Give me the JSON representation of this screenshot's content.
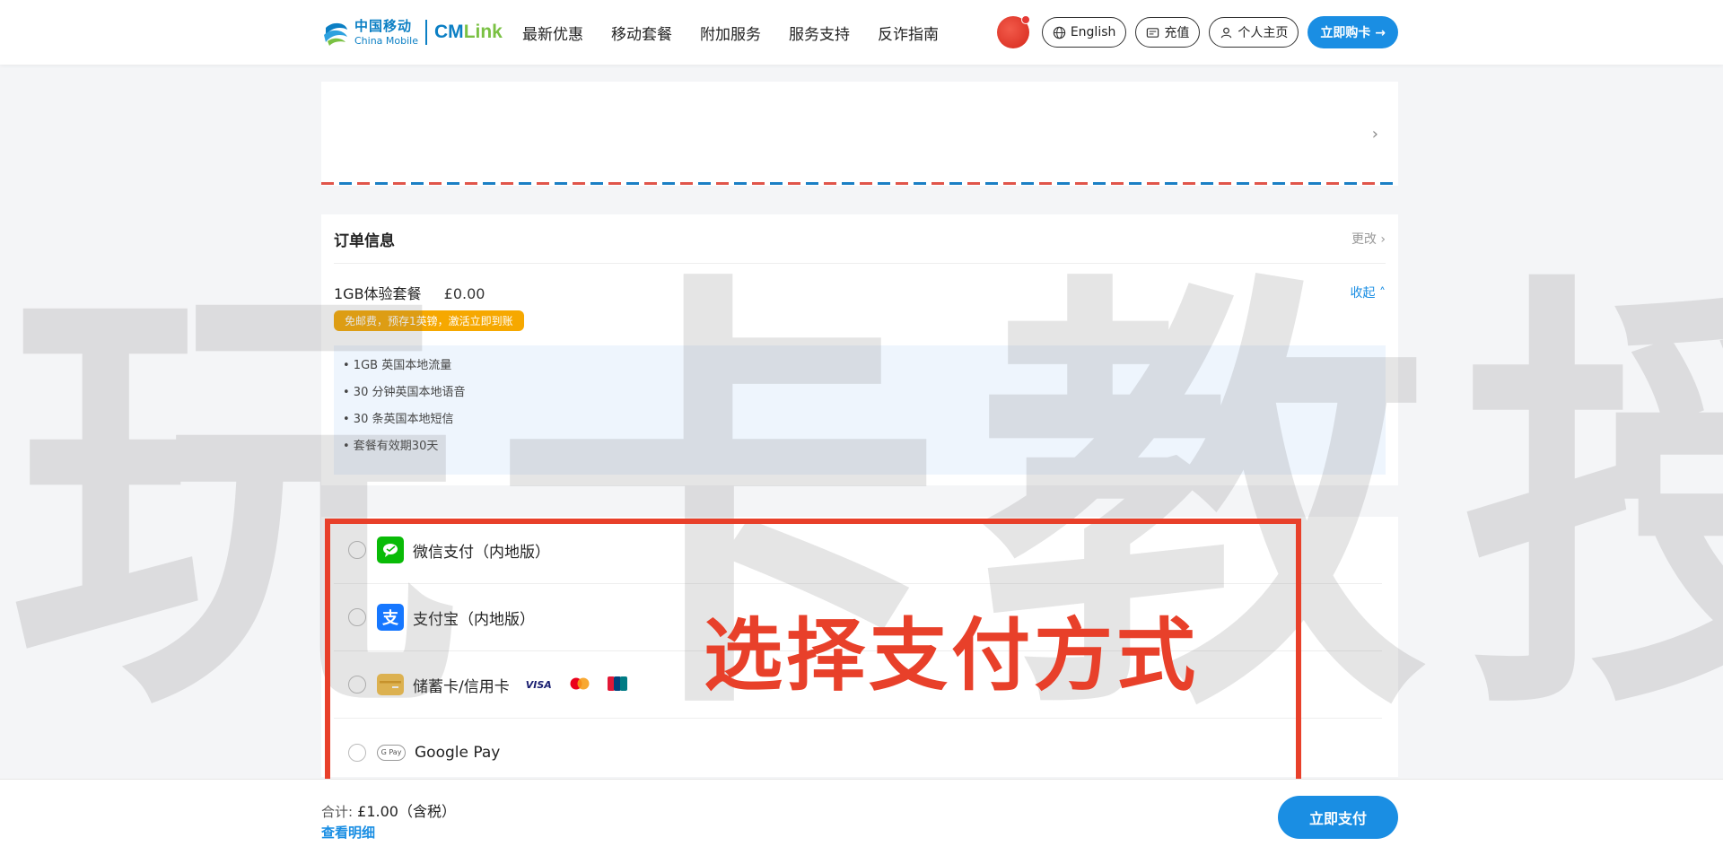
{
  "brand": {
    "cn": "中国移动",
    "en": "China Mobile",
    "cmlink_a": "CM",
    "cmlink_b": "Link",
    "primary_color": "#0b7fc4",
    "accent_color": "#1a8ee3"
  },
  "nav": {
    "items": [
      "最新优惠",
      "移动套餐",
      "附加服务",
      "服务支持",
      "反诈指南"
    ]
  },
  "header_actions": {
    "language": "English",
    "recharge": "充值",
    "account": "个人主页",
    "buy": "立即购卡 →"
  },
  "order": {
    "title": "订单信息",
    "change": "更改",
    "plan_name": "1GB体验套餐",
    "plan_price": "£0.00",
    "collapse": "收起",
    "promo": "免邮费，预存1英镑，激活立即到账",
    "features": [
      "• 1GB 英国本地流量",
      "• 30 分钟英国本地语音",
      "• 30 条英国本地短信",
      "• 套餐有效期30天"
    ]
  },
  "payment": {
    "options": [
      {
        "label": "微信支付（内地版）",
        "icon": "wechat-pay-icon"
      },
      {
        "label": "支付宝（内地版）",
        "icon": "alipay-icon"
      },
      {
        "label": "储蓄卡/信用卡",
        "icon": "bank-card-icon",
        "brands": [
          "VISA",
          "Mastercard",
          "UnionPay"
        ]
      },
      {
        "label": "Google Pay",
        "icon": "google-pay-icon"
      }
    ]
  },
  "annotation": {
    "text": "选择支付方式",
    "color": "#e8402a"
  },
  "watermark": "玩卡教授",
  "footer": {
    "total_label": "合计:",
    "total_value": "£1.00（含税）",
    "detail_link": "查看明细",
    "pay_button": "立即支付"
  }
}
